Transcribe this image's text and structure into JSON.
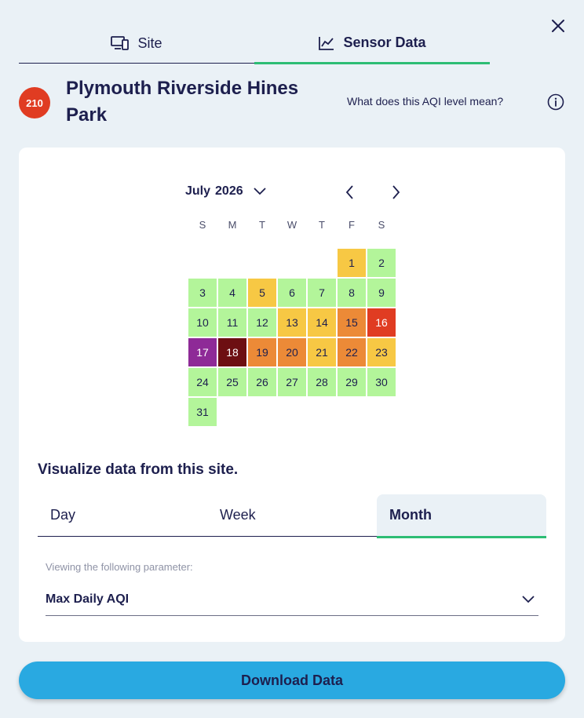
{
  "tabs": {
    "site_label": "Site",
    "sensor_label": "Sensor Data"
  },
  "site": {
    "aqi_value": "210",
    "name": "Plymouth Riverside Hines Park",
    "aqi_help_link": "What does this AQI level mean?"
  },
  "calendar": {
    "month": "July",
    "year": "2026",
    "weekdays": [
      "S",
      "M",
      "T",
      "W",
      "T",
      "F",
      "S"
    ],
    "leading_blanks": 5,
    "days": [
      {
        "n": "1",
        "color": "#f7c844",
        "fg": "#1d1f4e"
      },
      {
        "n": "2",
        "color": "#b3f59a",
        "fg": "#1d1f4e"
      },
      {
        "n": "3",
        "color": "#b3f59a",
        "fg": "#1d1f4e"
      },
      {
        "n": "4",
        "color": "#b3f59a",
        "fg": "#1d1f4e"
      },
      {
        "n": "5",
        "color": "#f7c844",
        "fg": "#1d1f4e"
      },
      {
        "n": "6",
        "color": "#b3f59a",
        "fg": "#1d1f4e"
      },
      {
        "n": "7",
        "color": "#b3f59a",
        "fg": "#1d1f4e"
      },
      {
        "n": "8",
        "color": "#b3f59a",
        "fg": "#1d1f4e"
      },
      {
        "n": "9",
        "color": "#b3f59a",
        "fg": "#1d1f4e"
      },
      {
        "n": "10",
        "color": "#b3f59a",
        "fg": "#1d1f4e"
      },
      {
        "n": "11",
        "color": "#b3f59a",
        "fg": "#1d1f4e"
      },
      {
        "n": "12",
        "color": "#b3f59a",
        "fg": "#1d1f4e"
      },
      {
        "n": "13",
        "color": "#f7c844",
        "fg": "#1d1f4e"
      },
      {
        "n": "14",
        "color": "#f7c844",
        "fg": "#1d1f4e"
      },
      {
        "n": "15",
        "color": "#ec8a37",
        "fg": "#1d1f4e"
      },
      {
        "n": "16",
        "color": "#e03c22",
        "fg": "#ffffff"
      },
      {
        "n": "17",
        "color": "#8e2a97",
        "fg": "#ffffff"
      },
      {
        "n": "18",
        "color": "#6d0f12",
        "fg": "#ffffff"
      },
      {
        "n": "19",
        "color": "#ec8a37",
        "fg": "#1d1f4e"
      },
      {
        "n": "20",
        "color": "#ec8a37",
        "fg": "#1d1f4e"
      },
      {
        "n": "21",
        "color": "#f7c844",
        "fg": "#1d1f4e"
      },
      {
        "n": "22",
        "color": "#ec8a37",
        "fg": "#1d1f4e"
      },
      {
        "n": "23",
        "color": "#f7c844",
        "fg": "#1d1f4e"
      },
      {
        "n": "24",
        "color": "#b3f59a",
        "fg": "#1d1f4e"
      },
      {
        "n": "25",
        "color": "#b3f59a",
        "fg": "#1d1f4e"
      },
      {
        "n": "26",
        "color": "#b3f59a",
        "fg": "#1d1f4e"
      },
      {
        "n": "27",
        "color": "#b3f59a",
        "fg": "#1d1f4e"
      },
      {
        "n": "28",
        "color": "#b3f59a",
        "fg": "#1d1f4e"
      },
      {
        "n": "29",
        "color": "#b3f59a",
        "fg": "#1d1f4e"
      },
      {
        "n": "30",
        "color": "#b3f59a",
        "fg": "#1d1f4e"
      },
      {
        "n": "31",
        "color": "#b3f59a",
        "fg": "#1d1f4e"
      }
    ]
  },
  "visualize": {
    "title": "Visualize data from this site.",
    "range_tabs": [
      "Day",
      "Week",
      "Month"
    ],
    "selected_range": "Month",
    "param_caption": "Viewing the following parameter:",
    "param_value": "Max Daily AQI"
  },
  "download_label": "Download Data",
  "colors": {
    "accent_green": "#2dbd74",
    "download_blue": "#29a9e1",
    "aqi_badge": "#e03c22"
  },
  "icons": [
    "close-icon",
    "devices-icon",
    "line-chart-icon",
    "info-icon",
    "chevron-down-icon",
    "chevron-left-icon",
    "chevron-right-icon"
  ]
}
